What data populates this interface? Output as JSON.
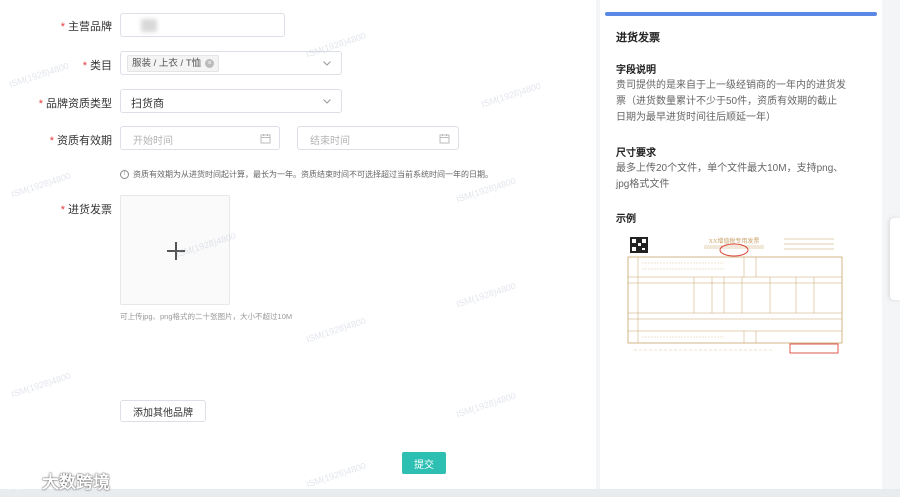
{
  "form": {
    "brand_label": "主营品牌",
    "category_label": "类目",
    "category_tag": "服装 / 上衣 / T恤",
    "qualification_label": "品牌资质类型",
    "qualification_value": "扫货商",
    "validity_label": "资质有效期",
    "start_placeholder": "开始时间",
    "end_placeholder": "结束时间",
    "validity_tip": "资质有效期为从进货时间起计算，最长为一年。资质结束时间不可选择超过当前系统时间一年的日期。",
    "invoice_label": "进货发票",
    "upload_hint": "可上传jpg、png格式的二十张图片，大小不超过10M",
    "add_brand_button": "添加其他品牌",
    "submit_button": "提交"
  },
  "side_panel": {
    "title": "进货发票",
    "field_desc_heading": "字段说明",
    "field_desc_text": "贵司提供的是来自于上一级经销商的一年内的进货发票（进货数量累计不少于50件，资质有效期的截止日期为最早进货时间往后顺延一年）",
    "size_heading": "尺寸要求",
    "size_text": "最多上传20个文件，单个文件最大10M，支持png、jpg格式文件",
    "example_heading": "示例",
    "invoice_title": "XX增值税专用发票"
  },
  "watermark": "ISM(1928)4800",
  "logo_text": "大数跨境",
  "colors": {
    "accent_bar": "#5b87e6",
    "submit": "#2dbfb2",
    "required": "#e4393c",
    "invoice_line": "#c9a26a",
    "invoice_stamp": "#d9473b"
  }
}
